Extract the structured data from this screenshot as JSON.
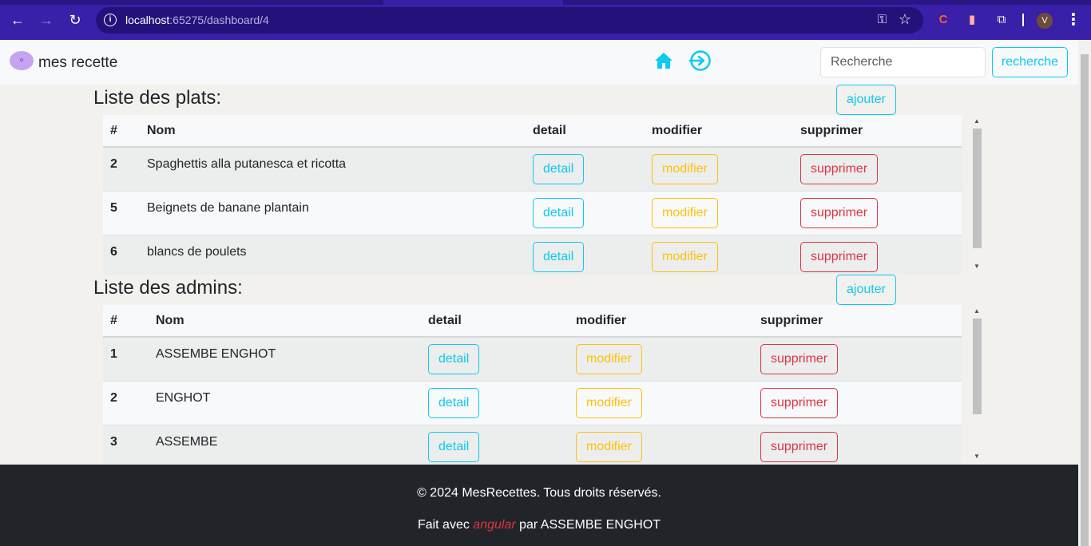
{
  "browser": {
    "url_host": "localhost",
    "url_rest": ":65275/dashboard/4",
    "profile_initial": "V"
  },
  "navbar": {
    "brand": "mes recette",
    "search_placeholder": "Recherche",
    "search_button": "recherche"
  },
  "plats": {
    "title": "Liste des plats:",
    "add_label": "ajouter",
    "headers": [
      "#",
      "Nom",
      "detail",
      "modifier",
      "supprimer"
    ],
    "rows": [
      {
        "id": "2",
        "nom": "Spaghettis alla putanesca et ricotta"
      },
      {
        "id": "5",
        "nom": "Beignets de banane plantain"
      },
      {
        "id": "6",
        "nom": "blancs de poulets"
      }
    ]
  },
  "admins": {
    "title": "Liste des admins:",
    "add_label": "ajouter",
    "headers": [
      "#",
      "Nom",
      "detail",
      "modifier",
      "supprimer"
    ],
    "rows": [
      {
        "id": "1",
        "nom": "ASSEMBE ENGHOT"
      },
      {
        "id": "2",
        "nom": "ENGHOT"
      },
      {
        "id": "3",
        "nom": "ASSEMBE"
      }
    ]
  },
  "buttons": {
    "detail": "detail",
    "modifier": "modifier",
    "supprimer": "supprimer"
  },
  "footer": {
    "copyright": "© 2024 MesRecettes. Tous droits réservés.",
    "made_prefix": "Fait avec ",
    "framework": "angular",
    "made_suffix": " par ASSEMBE ENGHOT"
  },
  "colors": {
    "info": "#0dcaf0",
    "warning": "#ffc107",
    "danger": "#dc3545",
    "chrome": "#3a1fa8"
  }
}
